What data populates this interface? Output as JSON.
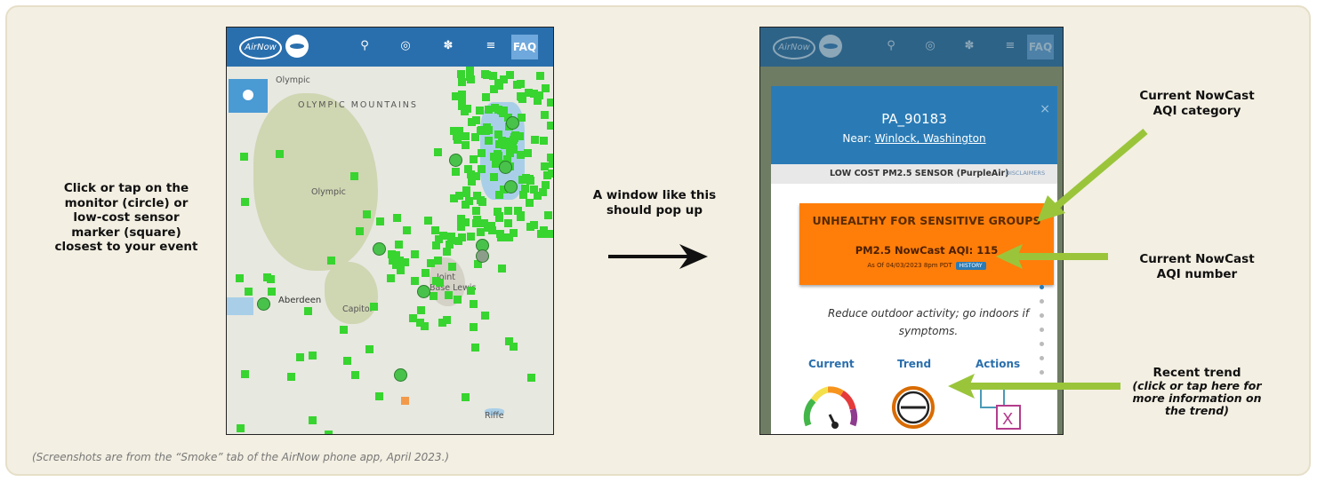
{
  "left_instruction": "Click or tap on the\nmonitor (circle) or\nlow-cost sensor\nmarker (square)\nclosest to your event",
  "middle_instruction": "A window like this\nshould pop up",
  "annotations": {
    "category": "Current NowCast\nAQI category",
    "number": "Current NowCast\nAQI number",
    "trend_title": "Recent trend",
    "trend_sub": "(click or tap here for\nmore information on\nthe trend)"
  },
  "caption": "(Screenshots are from the “Smoke” tab of the AirNow phone app, April 2023.)",
  "app": {
    "logo": "AirNow",
    "faq_label": "FAQ",
    "icons": [
      "search-icon",
      "globe-icon",
      "color-wheel-icon",
      "layers-icon"
    ]
  },
  "map": {
    "labels": [
      "Olympic\nNational\nPark",
      "OLYMPIC MOUNTAINS",
      "Olympic\nNational\nForest",
      "Aberdeen",
      "Capitol\nState\nForest",
      "Joint\nBase Lewis\nMcChord",
      "Riffe\nLake"
    ]
  },
  "popup": {
    "title": "PA_90183",
    "near_label": "Near:",
    "near_place": "Winlock, Washington",
    "close": "×",
    "sensor_type": "LOW COST PM2.5 SENSOR (PurpleAir)",
    "disclaimers": "DISCLAIMERS",
    "category": "UNHEALTHY FOR SENSITIVE GROUPS",
    "aqi_label": "PM2.5 NowCast AQI: 115",
    "as_of": "As Of 04/03/2023 8pm PDT",
    "history": "HISTORY",
    "advice": "Reduce outdoor activity; go indoors if symptoms.",
    "tabs": [
      "Current",
      "Trend",
      "Actions"
    ]
  },
  "colors": {
    "panel_bg": "#f3efe2",
    "app_bar": "#2a6fad",
    "aqi_orange": "#ff7e0a",
    "sensor_green": "#38d430",
    "arrow_green": "#9ac53b"
  }
}
